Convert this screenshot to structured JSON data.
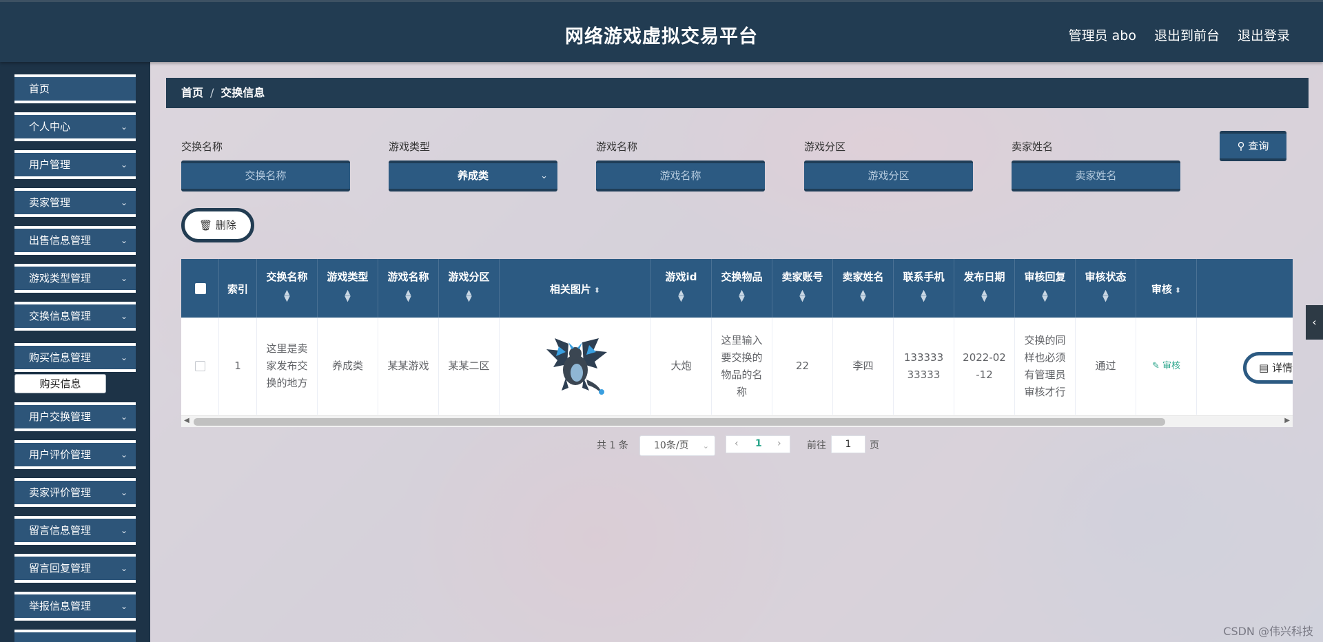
{
  "header": {
    "title": "网络游戏虚拟交易平台",
    "links": [
      "管理员 abo",
      "退出到前台",
      "退出登录"
    ]
  },
  "sidebar": {
    "items": [
      {
        "label": "首页",
        "expandable": false
      },
      {
        "label": "个人中心",
        "expandable": true
      },
      {
        "label": "用户管理",
        "expandable": true
      },
      {
        "label": "卖家管理",
        "expandable": true
      },
      {
        "label": "出售信息管理",
        "expandable": true
      },
      {
        "label": "游戏类型管理",
        "expandable": true
      },
      {
        "label": "交换信息管理",
        "expandable": true
      },
      {
        "label": "购买信息管理",
        "expandable": true
      },
      {
        "label": "用户交换管理",
        "expandable": true
      },
      {
        "label": "用户评价管理",
        "expandable": true
      },
      {
        "label": "卖家评价管理",
        "expandable": true
      },
      {
        "label": "留言信息管理",
        "expandable": true
      },
      {
        "label": "留言回复管理",
        "expandable": true
      },
      {
        "label": "举报信息管理",
        "expandable": true
      }
    ],
    "submenu": {
      "label": "购买信息"
    }
  },
  "breadcrumb": {
    "home": "首页",
    "separator": "/",
    "current": "交换信息"
  },
  "search": {
    "fields": [
      {
        "label": "交换名称",
        "placeholder": "交换名称"
      },
      {
        "label": "游戏类型",
        "value": "养成类"
      },
      {
        "label": "游戏名称",
        "placeholder": "游戏名称"
      },
      {
        "label": "游戏分区",
        "placeholder": "游戏分区"
      },
      {
        "label": "卖家姓名",
        "placeholder": "卖家姓名"
      }
    ],
    "query_label": "查询",
    "delete_label": "删除"
  },
  "table": {
    "headers": [
      "索引",
      "交换名称",
      "游戏类型",
      "游戏名称",
      "游戏分区",
      "相关图片",
      "游戏id",
      "交换物品",
      "卖家账号",
      "卖家姓名",
      "联系手机",
      "发布日期",
      "审核回复",
      "审核状态",
      "审核"
    ],
    "rows": [
      {
        "index": "1",
        "name": "这里是卖家发布交换的地方",
        "game_type": "养成类",
        "game_name": "某某游戏",
        "zone": "某某二区",
        "image": "dragon-image",
        "game_id": "大炮",
        "item": "这里输入要交换的物品的名称",
        "seller_account": "22",
        "seller_name": "李四",
        "phone": "13333333333",
        "date": "2022-02-12",
        "reply": "交换的同样也必须有管理员审核才行",
        "status": "通过",
        "audit_label": "审核",
        "detail_label": "详情"
      }
    ]
  },
  "pagination": {
    "total": "共 1 条",
    "page_size": "10条/页",
    "current_page": "1",
    "goto_label": "前往",
    "goto_value": "1",
    "page_suffix": "页"
  },
  "watermark": "CSDN @伟兴科技"
}
